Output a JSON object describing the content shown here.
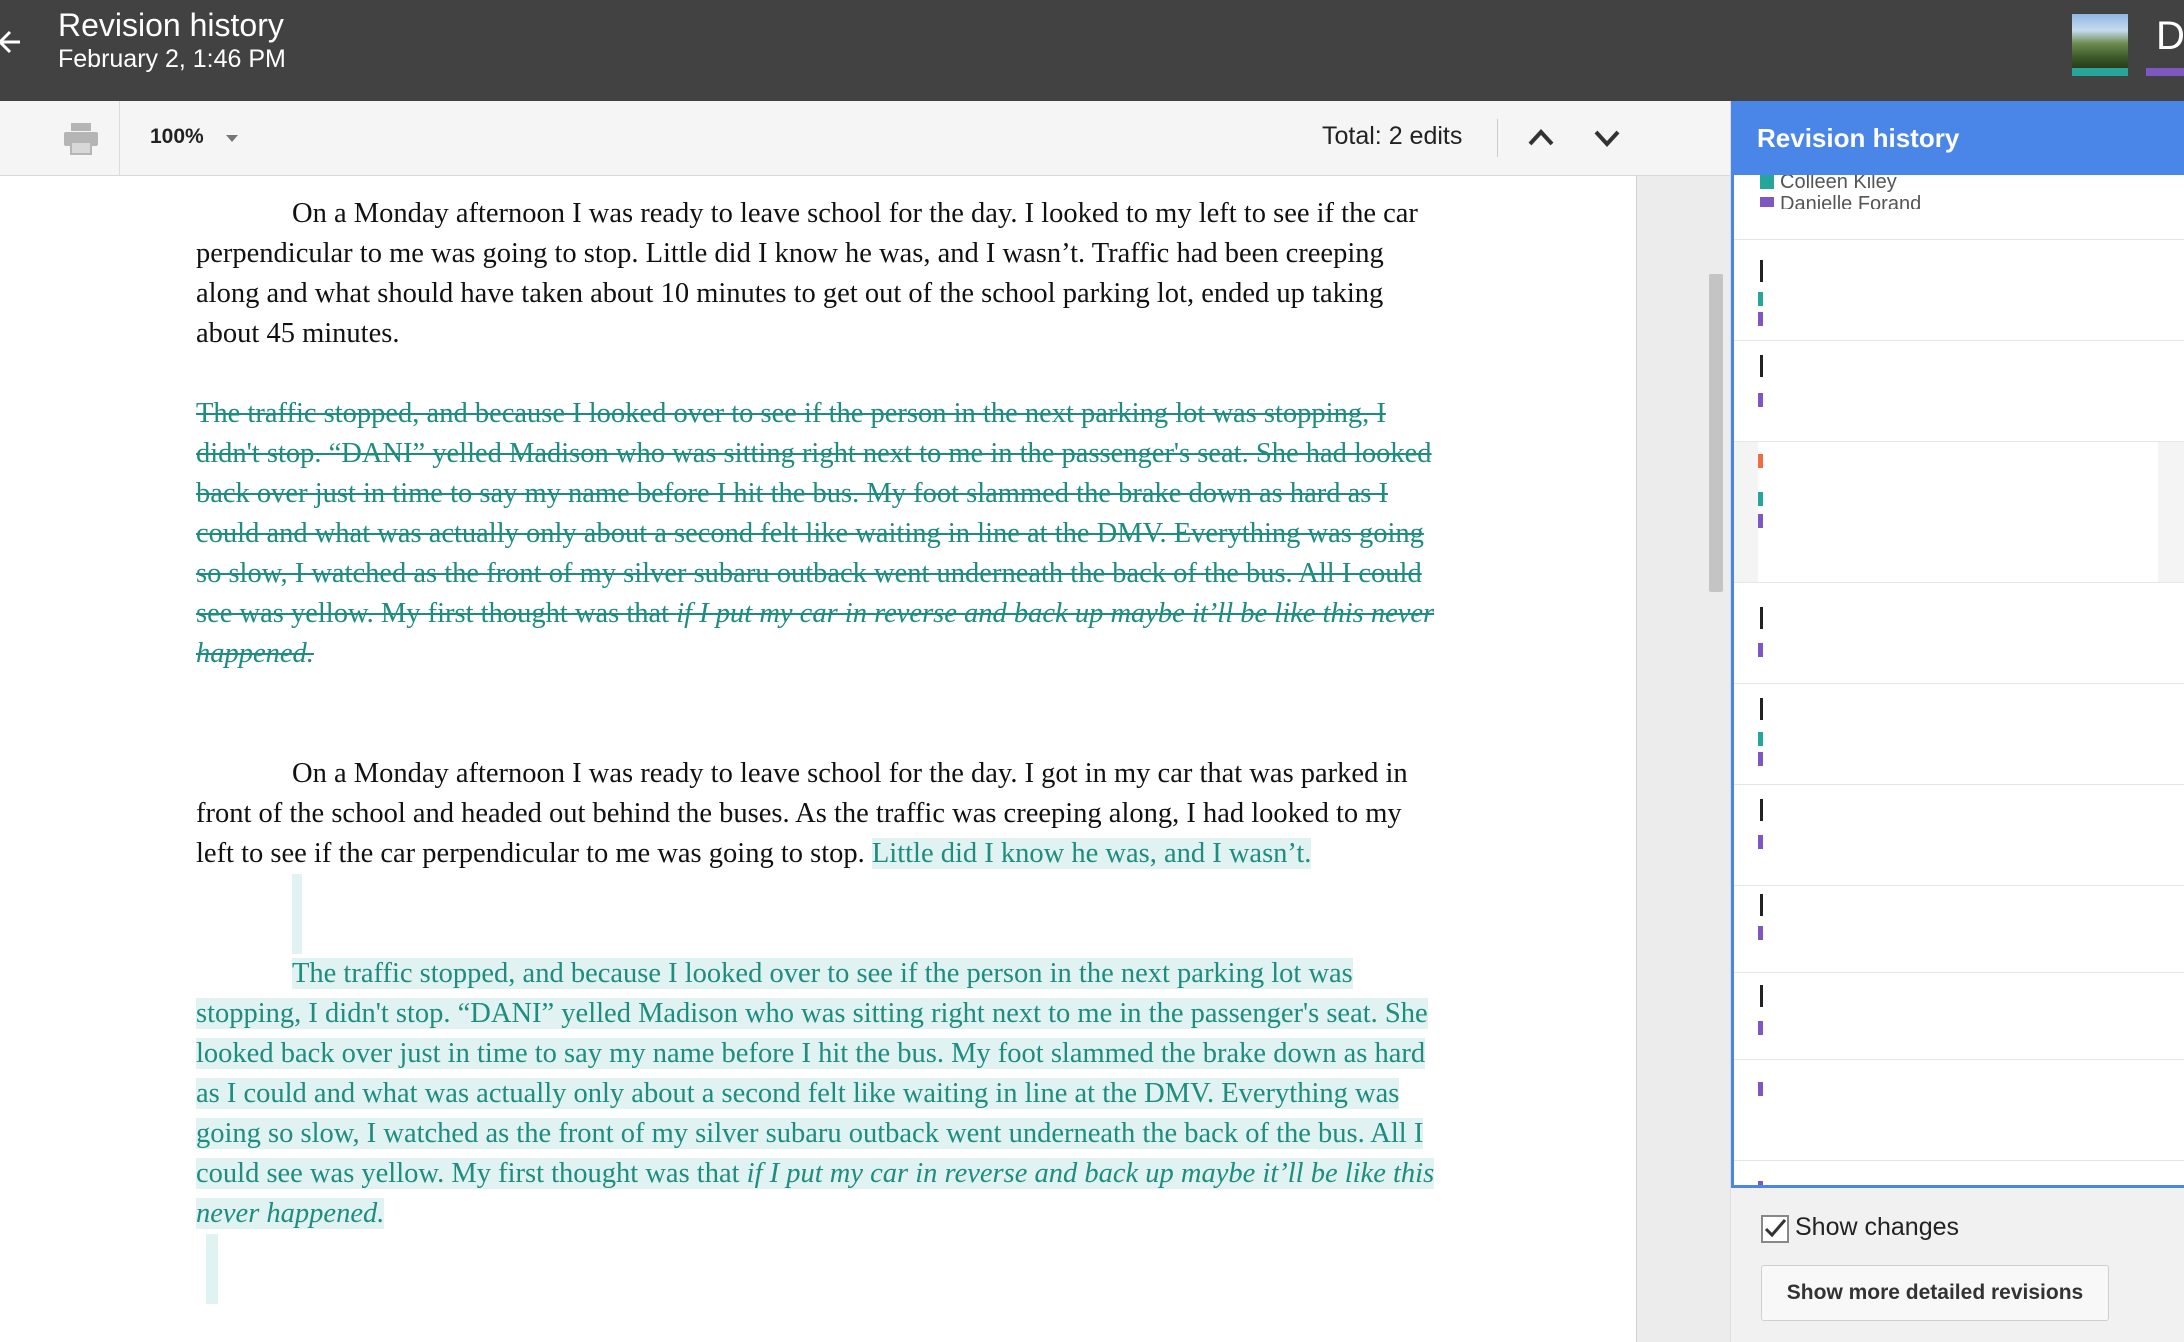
{
  "header": {
    "title": "Revision history",
    "subtitle": "February 2, 1:46 PM",
    "account_initial": "D"
  },
  "toolbar": {
    "zoom": "100%",
    "total_edits": "Total: 2 edits"
  },
  "document": {
    "p1": "On a Monday afternoon I was ready to leave school for the day. I looked to my left to see if the car perpendicular to me was going to stop. Little did I know he was, and I wasn’t. Traffic had been creeping along and what should have taken about 10 minutes to get out of the school parking lot, ended up taking about 45 minutes.",
    "deleted_text": "The traffic stopped, and because I looked over to see if the person in the next parking lot was stopping, I didn't stop. “DANI” yelled Madison who was sitting right next to me in the passenger's seat. She had looked back over just in time to say my name before I hit the bus. My foot slammed the brake down as hard as I could and what was actually only about a second felt like waiting in line at the DMV. Everything was going so slow, I watched as the front of my silver subaru outback went underneath the back of the bus. All I could see was yellow. My first thought was that ",
    "deleted_italic": "if I put my car in reverse and back up maybe it’ll be like this never happened.",
    "p3_plain": "On a Monday afternoon I was ready to leave school for the day. I got in my car that was parked in front of the school and headed out behind the buses. As the traffic was creeping along, I had looked to my left to see if the car perpendicular to me was going to stop. ",
    "p3_added": "Little did I know he was, and I wasn’t.",
    "added_text": "The traffic stopped, and because I looked over to see if the person in the next parking lot was stopping, I didn't stop. “DANI” yelled Madison who was sitting right next to me in the passenger's seat. She looked back over just in time to say my name before I hit the bus. My foot slammed the brake down as hard as I could and what was actually only about a second felt like waiting in line at the DMV. Everything was going so slow, I watched as the front of my silver subaru outback went underneath the back of the bus. All I could see was yellow. My first thought was that ",
    "added_italic": "if I put my car in reverse and back up maybe it’ll be like this never happened."
  },
  "panel": {
    "title": "Revision history",
    "editors": [
      "Colleen Kiley",
      "Danielle Forand"
    ],
    "show_changes_label": "Show changes",
    "more_revisions_label": "Show more detailed revisions",
    "show_changes_checked": true
  },
  "colors": {
    "accent": "#4a86e8",
    "editor1": "#26a69a",
    "editor2": "#7e57c2",
    "editor3": "#ef6c45"
  }
}
